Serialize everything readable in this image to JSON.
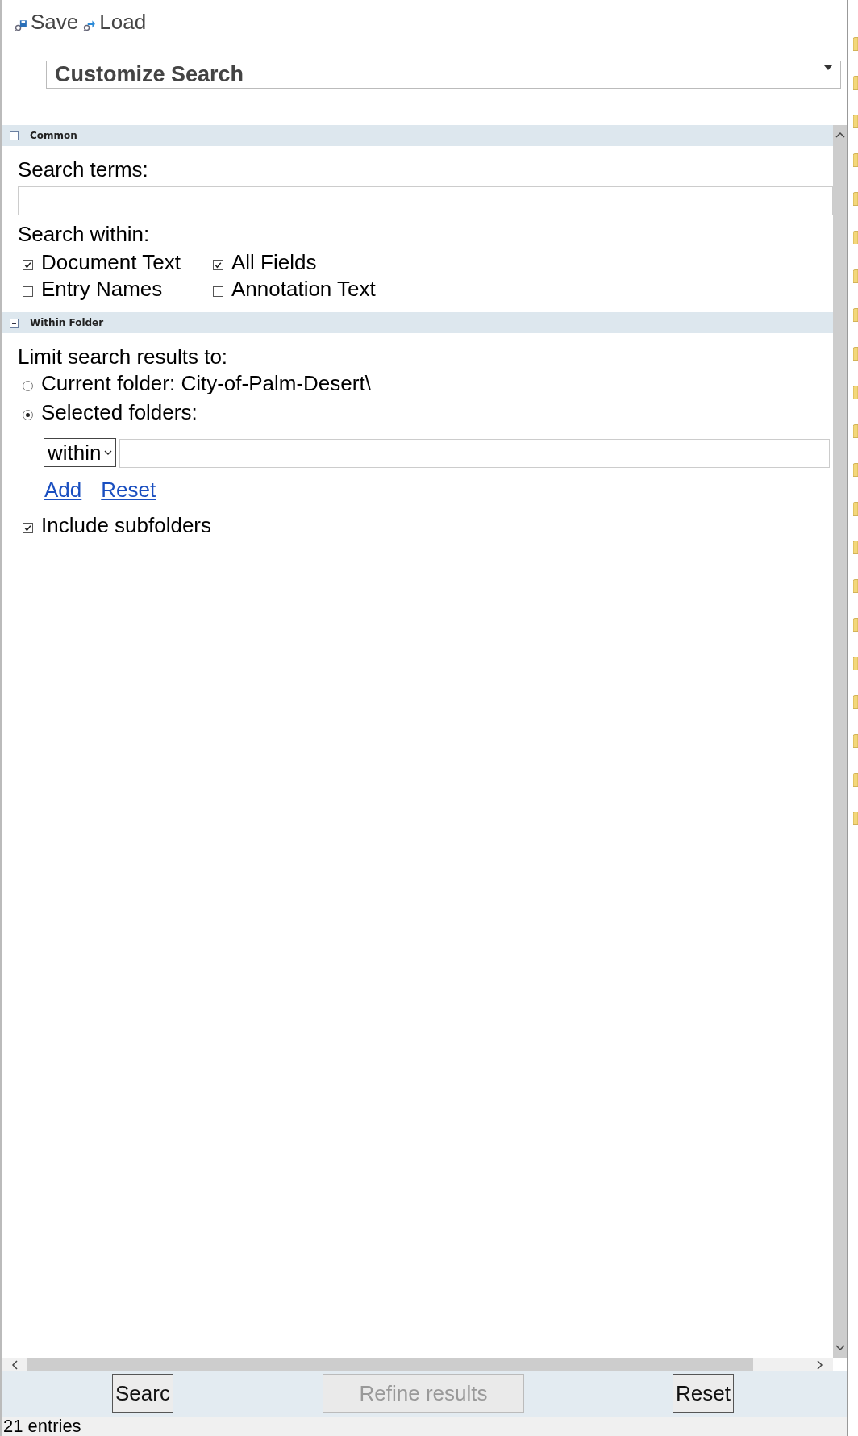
{
  "toolbar": [
    {
      "label": "Save",
      "kind": "save"
    },
    {
      "label": "Load",
      "kind": "load"
    }
  ],
  "search_type": {
    "value": "Customize Search"
  },
  "common": {
    "title": "Common",
    "expanded": true,
    "search_terms_label": "Search terms:",
    "search_within_label": "Search within:",
    "options": [
      {
        "label": "Document Text",
        "checked": true
      },
      {
        "label": "All Fields",
        "checked": true
      },
      {
        "label": "Entry Names",
        "checked": false
      },
      {
        "label": "Annotation Text",
        "checked": false
      }
    ]
  },
  "within_folder": {
    "title": "Within Folder",
    "expanded": true,
    "limit_label": "Limit search results to:",
    "scopes": [
      {
        "label": "Current folder: City-of-Palm-Desert\\",
        "selected": false
      },
      {
        "label": "Selected folders:",
        "selected": true
      }
    ],
    "mode_select": {
      "value": "within"
    },
    "links": [
      "Add",
      "Reset"
    ],
    "include_subfolders": {
      "label": "Include subfolders",
      "checked": true
    }
  },
  "buttons": [
    {
      "label": "Searc",
      "disabled": false
    },
    {
      "label": "Refine results",
      "disabled": true
    },
    {
      "label": "Reset",
      "disabled": false
    }
  ],
  "status_bar": {
    "text": "21 entries"
  }
}
